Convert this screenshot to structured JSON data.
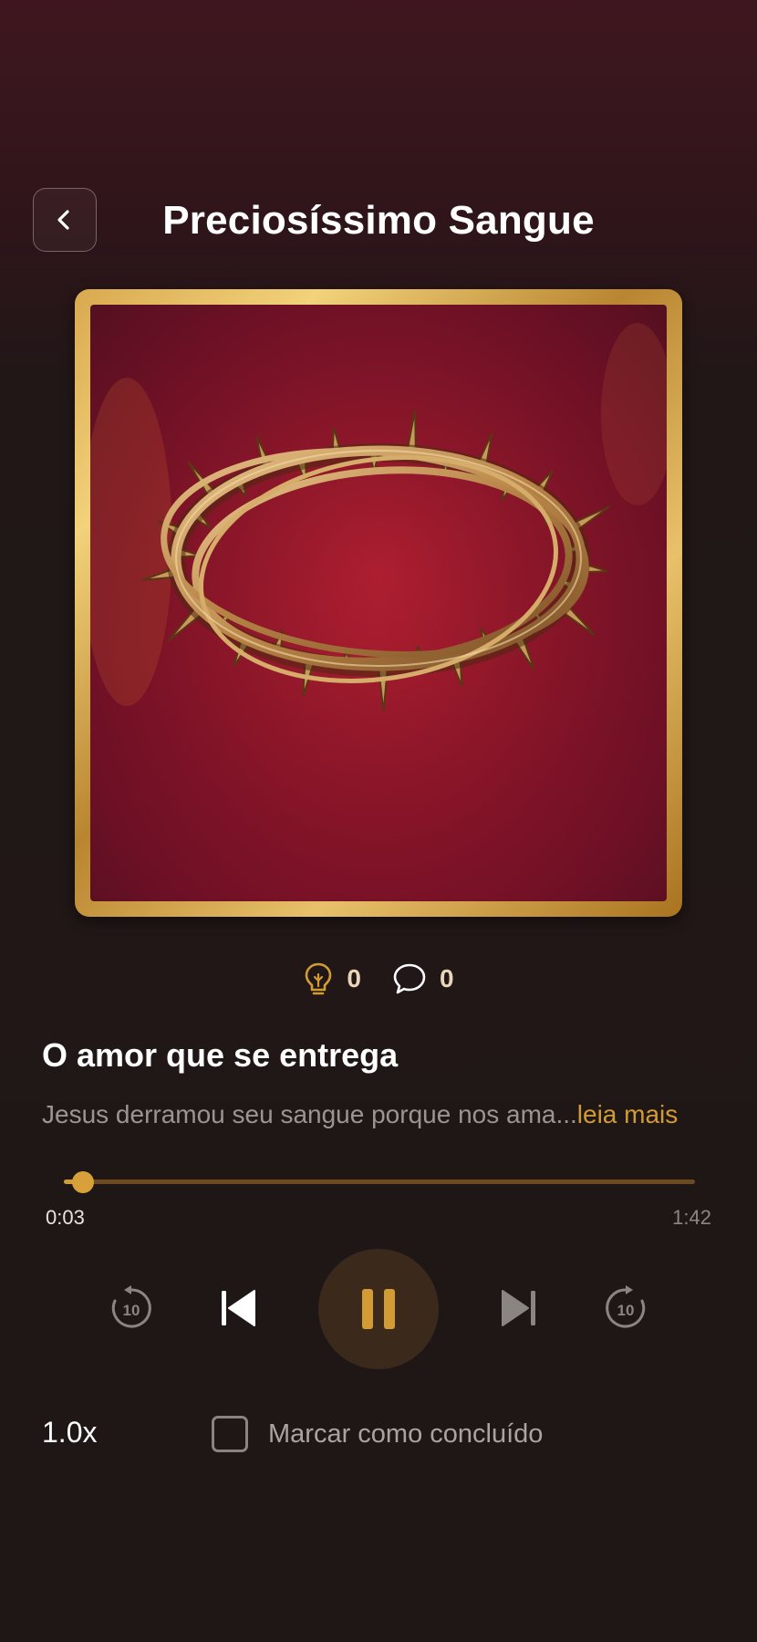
{
  "header": {
    "title": "Preciosíssimo Sangue",
    "back_icon": "chevron-left-icon"
  },
  "artwork": {
    "subject": "crown-of-thorns",
    "frame_color": "#d9a94f",
    "background_color": "#8a1428"
  },
  "stats": {
    "insights": {
      "icon": "lightbulb-icon",
      "count": "0"
    },
    "comments": {
      "icon": "comment-bubble-icon",
      "count": "0"
    }
  },
  "episode": {
    "title": "O amor que se entrega",
    "description": "Jesus derramou seu sangue porque nos ama...",
    "read_more": "leia mais"
  },
  "player": {
    "current_time": "0:03",
    "total_time": "1:42",
    "progress_fraction": 0.03,
    "rewind_label": "10",
    "forward_label": "10",
    "state": "playing"
  },
  "footer": {
    "speed": "1.0x",
    "mark_done_label": "Marcar como concluído",
    "mark_done_checked": false
  },
  "colors": {
    "accent": "#d39b34",
    "play_button_bg": "#3b2a1b",
    "text_secondary": "#9d9490"
  }
}
